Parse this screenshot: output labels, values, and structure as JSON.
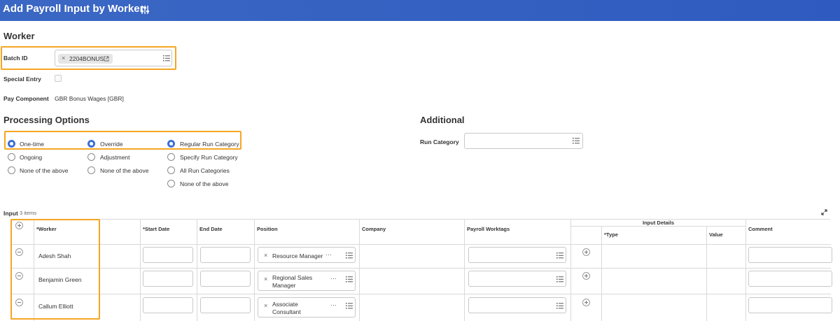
{
  "header": {
    "title": "Add Payroll Input by Worker",
    "tune_icon": "sliders-icon"
  },
  "worker_section": {
    "title": "Worker",
    "batch_id_label": "Batch ID",
    "batch_id_value": "2204BONUS",
    "special_entry_label": "Special Entry",
    "pay_component_label": "Pay Component",
    "pay_component_value": "GBR Bonus Wages [GBR]"
  },
  "processing": {
    "title": "Processing Options",
    "col1": [
      "One-time",
      "Ongoing",
      "None of the above"
    ],
    "col2": [
      "Override",
      "Adjustment",
      "None of the above"
    ],
    "col3": [
      "Regular Run Category",
      "Specify Run Category",
      "All Run Categories",
      "None of the above"
    ],
    "selected": [
      "One-time",
      "Override",
      "Regular Run Category"
    ]
  },
  "additional": {
    "title": "Additional",
    "run_category_label": "Run Category"
  },
  "input_table": {
    "label": "Input",
    "count": "3 items",
    "group_header": "Input Details",
    "headers": {
      "worker": "*Worker",
      "start": "*Start Date",
      "end": "End Date",
      "position": "Position",
      "company": "Company",
      "worktags": "Payroll Worktags",
      "type": "*Type",
      "value": "Value",
      "comment": "Comment"
    },
    "rows": [
      {
        "worker": "Adesh Shah",
        "position_line1": "Resource Manager",
        "position_line2": ""
      },
      {
        "worker": "Benjamin Green",
        "position_line1": "Regional Sales",
        "position_line2": "Manager"
      },
      {
        "worker": "Callum Elliott",
        "position_line1": "Associate",
        "position_line2": "Consultant"
      }
    ]
  },
  "colors": {
    "header_blue": "#2f5bc0",
    "highlight": "#f5a623",
    "radio_on": "#3b6fd8"
  }
}
